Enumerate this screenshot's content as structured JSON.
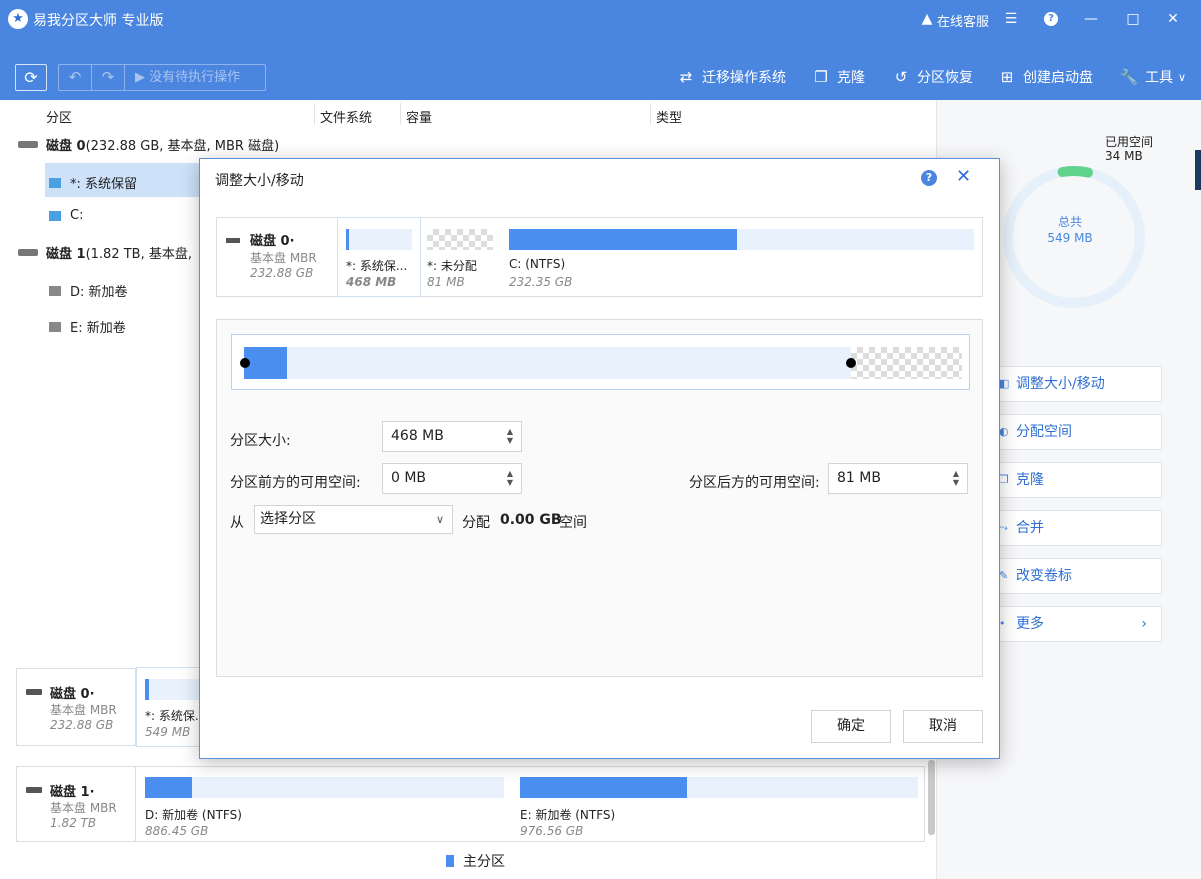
{
  "app": {
    "title": "易我分区大师 专业版",
    "support": "在线客服",
    "logo_icon": "star-logo-icon"
  },
  "toolbar": {
    "pending": "没有待执行操作",
    "migrate": "迁移操作系统",
    "clone": "克隆",
    "recover": "分区恢复",
    "bootable": "创建启动盘",
    "tools": "工具"
  },
  "columns": {
    "partition": "分区",
    "filesystem": "文件系统",
    "capacity": "容量",
    "type": "类型"
  },
  "tree": {
    "disk0": {
      "name": "磁盘 0",
      "info": " (232.88 GB, 基本盘, MBR 磁盘)"
    },
    "disk0_parts": [
      "*: 系统保留",
      "C:"
    ],
    "disk1": {
      "name": "磁盘 1",
      "info": " (1.82 TB, 基本盘, "
    },
    "disk1_parts": [
      "D: 新加卷",
      "E: 新加卷"
    ]
  },
  "right_panel": {
    "used_label": "已用空间",
    "used_value": "34 MB",
    "total_label": "总共",
    "total_value": "549 MB",
    "used_fraction": 0.062,
    "actions": [
      "调整大小/移动",
      "分配空间",
      "克隆",
      "合并",
      "改变卷标",
      "更多"
    ],
    "colors": {
      "used": "#5fd38d",
      "ring": "#e6f0fb"
    }
  },
  "bottom": {
    "disk0": {
      "name": "磁盘 0·",
      "type": "基本盘 MBR",
      "size": "232.88 GB",
      "parts": [
        {
          "label": "*: 系统保.",
          "size": "549 MB"
        }
      ]
    },
    "disk1": {
      "name": "磁盘 1·",
      "type": "基本盘 MBR",
      "size": "1.82 TB",
      "parts": [
        {
          "label": "D: 新加卷 (NTFS)",
          "size": "886.45 GB",
          "used_fraction": 0.13
        },
        {
          "label": "E: 新加卷 (NTFS)",
          "size": "976.56 GB",
          "used_fraction": 0.42
        }
      ]
    },
    "legend": "主分区"
  },
  "dialog": {
    "title": "调整大小/移动",
    "disk": {
      "name": "磁盘 0·",
      "type": "基本盘 MBR",
      "size": "232.88 GB"
    },
    "parts": [
      {
        "label": "*: 系统保...",
        "size": "468 MB"
      },
      {
        "label": "*: 未分配",
        "size": "81 MB"
      },
      {
        "label": "C:  (NTFS)",
        "size": "232.35 GB",
        "used_fraction": 0.49
      }
    ],
    "fields": {
      "size_label": "分区大小:",
      "size_value": "468 MB",
      "before_label": "分区前方的可用空间:",
      "before_value": "0 MB",
      "after_label": "分区后方的可用空间:",
      "after_value": "81 MB",
      "from_label": "从",
      "from_select": "选择分区",
      "allocate_label": "分配",
      "allocate_value": "0.00 GB",
      "space_label": "空间"
    },
    "buttons": {
      "ok": "确定",
      "cancel": "取消"
    }
  }
}
